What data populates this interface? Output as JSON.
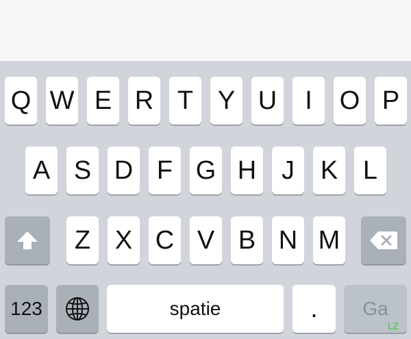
{
  "keyboard": {
    "row1": [
      "Q",
      "W",
      "E",
      "R",
      "T",
      "Y",
      "U",
      "I",
      "O",
      "P"
    ],
    "row2": [
      "A",
      "S",
      "D",
      "F",
      "G",
      "H",
      "J",
      "K",
      "L"
    ],
    "row3": [
      "Z",
      "X",
      "C",
      "V",
      "B",
      "N",
      "M"
    ],
    "bottom": {
      "numbers_label": "123",
      "space_label": "spatie",
      "period_label": ".",
      "go_label": "Ga"
    },
    "icons": {
      "shift": "shift-arrow-icon",
      "delete": "backspace-icon",
      "globe": "globe-icon"
    },
    "colors": {
      "keyboard_bg": "#d1d5db",
      "key_bg": "#ffffff",
      "special_key_bg": "#a9b0b8",
      "go_key_bg": "#bcc2ca"
    }
  },
  "watermark": "LZ"
}
